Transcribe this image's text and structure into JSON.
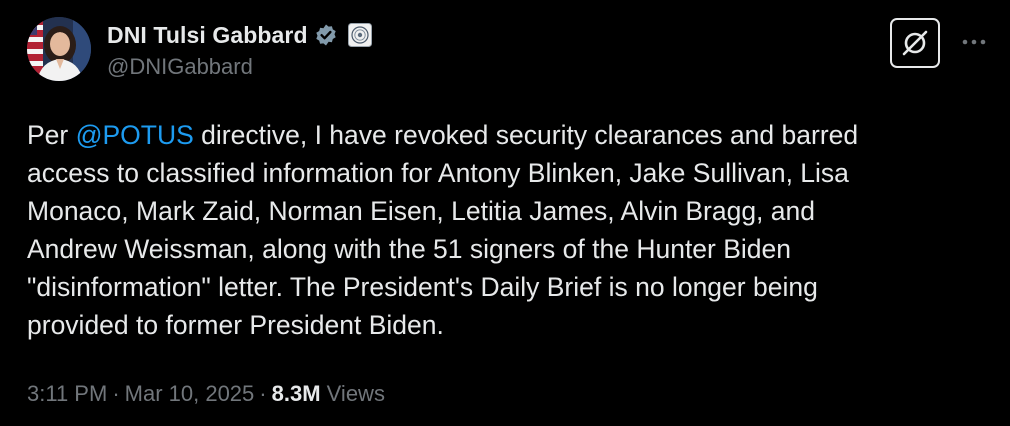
{
  "author": {
    "display_name": "DNI Tulsi Gabbard",
    "handle": "@DNIGabbard",
    "avatar_icon": "profile-photo",
    "verified_icon": "verified-badge-icon",
    "affiliation_icon": "government-seal-icon"
  },
  "actions": {
    "grok_icon": "grok-icon",
    "more_icon": "more-options-icon"
  },
  "tweet": {
    "line1_prefix": "Per ",
    "mention": "@POTUS",
    "line1_suffix": " directive, I have revoked security clearances and barred",
    "line2": "access to classified information for Antony Blinken, Jake Sullivan, Lisa",
    "line3": "Monaco, Mark Zaid, Norman Eisen, Letitia James, Alvin Bragg, and",
    "line4": "Andrew Weissman, along with the 51 signers of the Hunter Biden",
    "line5": "\"disinformation\" letter. The President's Daily Brief is no longer being",
    "line6": "provided to former President Biden."
  },
  "meta": {
    "time": "3:11 PM",
    "separator": "·",
    "date": "Mar 10, 2025",
    "views_count": "8.3M",
    "views_label": "Views"
  },
  "colors": {
    "background": "#000000",
    "text_primary": "#e7e9ea",
    "text_secondary": "#71767b",
    "link": "#1d9bf0",
    "verified": "#829aab"
  }
}
